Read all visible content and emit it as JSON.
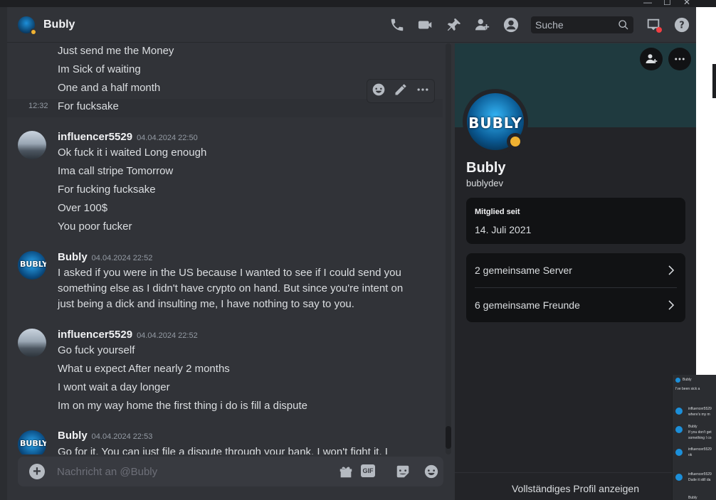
{
  "header": {
    "title": "Bubly",
    "search_placeholder": "Suche"
  },
  "messages_top": [
    {
      "text": "Just send me the Money"
    },
    {
      "text": "Im Sick of waiting"
    },
    {
      "text": "One and a half month"
    },
    {
      "text": "For fucksake",
      "time": "12:32"
    }
  ],
  "groups": [
    {
      "author": "influencer5529",
      "timestamp": "04.04.2024 22:50",
      "lines": [
        "Ok fuck it i waited Long enough",
        "Ima call stripe Tomorrow",
        "For fucking fucksake",
        "Over 100$",
        "You poor fucker"
      ]
    },
    {
      "author": "Bubly",
      "timestamp": "04.04.2024 22:52",
      "lines": [
        "I asked if you were in the US because I wanted to see if I could send you",
        "something else as I didn't have crypto on hand. But since you're intent on",
        "just being a dick and insulting me, I have nothing to say to you."
      ]
    },
    {
      "author": "influencer5529",
      "timestamp": "04.04.2024 22:52",
      "lines": [
        "Go fuck yourself",
        "What u expect After nearly 2 months",
        "I wont wait a day longer",
        "Im on my way home the first thing i do is fill a dispute"
      ]
    },
    {
      "author": "Bubly",
      "timestamp": "04.04.2024 22:53",
      "lines": [
        "Go for it. You can just file a dispute through your bank. I won't fight it. I"
      ]
    }
  ],
  "composer": {
    "placeholder": "Nachricht an @Bubly",
    "gif_label": "GIF"
  },
  "avatar_logo": "BUBLY",
  "avatar_logo_small": "BUBLY",
  "profile": {
    "name": "Bubly",
    "handle": "bublydev",
    "member_since_label": "Mitglied seit",
    "member_since_value": "14. Juli 2021",
    "mutual_servers": "2 gemeinsame Server",
    "mutual_friends": "6 gemeinsame Freunde",
    "full_profile": "Vollständiges Profil anzeigen"
  },
  "thumbnail": {
    "title": "Bubly",
    "lines": [
      "I've been sick a",
      "influencer5529",
      "where's my m",
      "Bubly",
      "If you don't get",
      "something I co",
      "influencer5529",
      "ok",
      "influencer5529",
      "Dude it still da",
      "Bubly"
    ]
  },
  "colors": {
    "status_idle": "#f0b232",
    "banner": "#1f3a3f",
    "background": "#313338"
  }
}
